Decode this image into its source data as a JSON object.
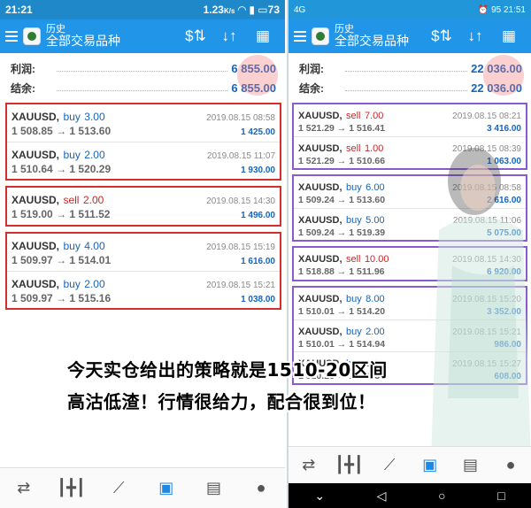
{
  "left": {
    "status": {
      "time": "21:21",
      "network_speed": "1.23",
      "network_unit": "K/s",
      "battery": "73"
    },
    "header": {
      "title": "历史",
      "subtitle": "全部交易品种"
    },
    "summary": {
      "profit_label": "利润:",
      "profit_value": "6 855.00",
      "balance_label": "结余:",
      "balance_value": "6 855.00"
    },
    "groups": [
      [
        {
          "symbol": "XAUUSD,",
          "side": "buy",
          "lots": "3.00",
          "time": "2019.08.15 08:58",
          "open": "1 508.85",
          "close": "1 513.60",
          "profit": "1 425.00"
        },
        {
          "symbol": "XAUUSD,",
          "side": "buy",
          "lots": "2.00",
          "time": "2019.08.15 11:07",
          "open": "1 510.64",
          "close": "1 520.29",
          "profit": "1 930.00"
        }
      ],
      [
        {
          "symbol": "XAUUSD,",
          "side": "sell",
          "lots": "2.00",
          "time": "2019.08.15 14:30",
          "open": "1 519.00",
          "close": "1 511.52",
          "profit": "1 496.00"
        }
      ],
      [
        {
          "symbol": "XAUUSD,",
          "side": "buy",
          "lots": "4.00",
          "time": "2019.08.15 15:19",
          "open": "1 509.97",
          "close": "1 514.01",
          "profit": "1 616.00"
        },
        {
          "symbol": "XAUUSD,",
          "side": "buy",
          "lots": "2.00",
          "time": "2019.08.15 15:21",
          "open": "1 509.97",
          "close": "1 515.16",
          "profit": "1 038.00"
        }
      ]
    ]
  },
  "right": {
    "status": {
      "signal": "4G",
      "time": "21:51",
      "battery": "95"
    },
    "header": {
      "title": "历史",
      "subtitle": "全部交易品种"
    },
    "summary": {
      "profit_label": "利润:",
      "profit_value": "22 036.00",
      "balance_label": "结余:",
      "balance_value": "22 036.00"
    },
    "groups": [
      [
        {
          "symbol": "XAUUSD,",
          "side": "sell",
          "lots": "7.00",
          "time": "2019.08.15 08:21",
          "open": "1 521.29",
          "close": "1 516.41",
          "profit": "3 416.00"
        },
        {
          "symbol": "XAUUSD,",
          "side": "sell",
          "lots": "1.00",
          "time": "2019.08.15 08:39",
          "open": "1 521.29",
          "close": "1 510.66",
          "profit": "1 063.00"
        }
      ],
      [
        {
          "symbol": "XAUUSD,",
          "side": "buy",
          "lots": "6.00",
          "time": "2019.08.15 08:58",
          "open": "1 509.24",
          "close": "1 513.60",
          "profit": "2 616.00"
        },
        {
          "symbol": "XAUUSD,",
          "side": "buy",
          "lots": "5.00",
          "time": "2019.08.15 11:06",
          "open": "1 509.24",
          "close": "1 519.39",
          "profit": "5 075.00"
        }
      ],
      [
        {
          "symbol": "XAUUSD,",
          "side": "sell",
          "lots": "10.00",
          "time": "2019.08.15 14:30",
          "open": "1 518.88",
          "close": "1 511.96",
          "profit": "6 920.00"
        }
      ],
      [
        {
          "symbol": "XAUUSD,",
          "side": "buy",
          "lots": "8.00",
          "time": "2019.08.15 15:20",
          "open": "1 510.01",
          "close": "1 514.20",
          "profit": "3 352.00"
        },
        {
          "symbol": "XAUUSD,",
          "side": "buy",
          "lots": "2.00",
          "time": "2019.08.15 15:21",
          "open": "1 510.01",
          "close": "1 514.94",
          "profit": "986.00"
        },
        {
          "symbol": "XAUUSD,",
          "side": "buy",
          "lots": "1.00",
          "time": "2019.08.15 15:27",
          "open": "1 510.26",
          "close": "1 516.34",
          "profit": "608.00"
        }
      ]
    ]
  },
  "overlay": {
    "line1": "今天实仓给出的策略就是1510-20区间",
    "line2": "高沽低渣！行情很给力，配合很到位！"
  },
  "colors": {
    "accent": "#2196e8",
    "buy": "#1565c0",
    "sell": "#c62828",
    "left_border": "#d32f2f",
    "right_border": "#8a5bd0"
  },
  "icons": {
    "appbar": [
      "currency-exchange-icon",
      "sort-icon",
      "calendar-icon"
    ],
    "bottom_nav": [
      "quotes-icon",
      "chart-candles-icon",
      "trade-icon",
      "history-icon",
      "news-icon",
      "chat-icon"
    ],
    "system_nav": [
      "back-icon",
      "home-icon",
      "recents-icon"
    ]
  }
}
